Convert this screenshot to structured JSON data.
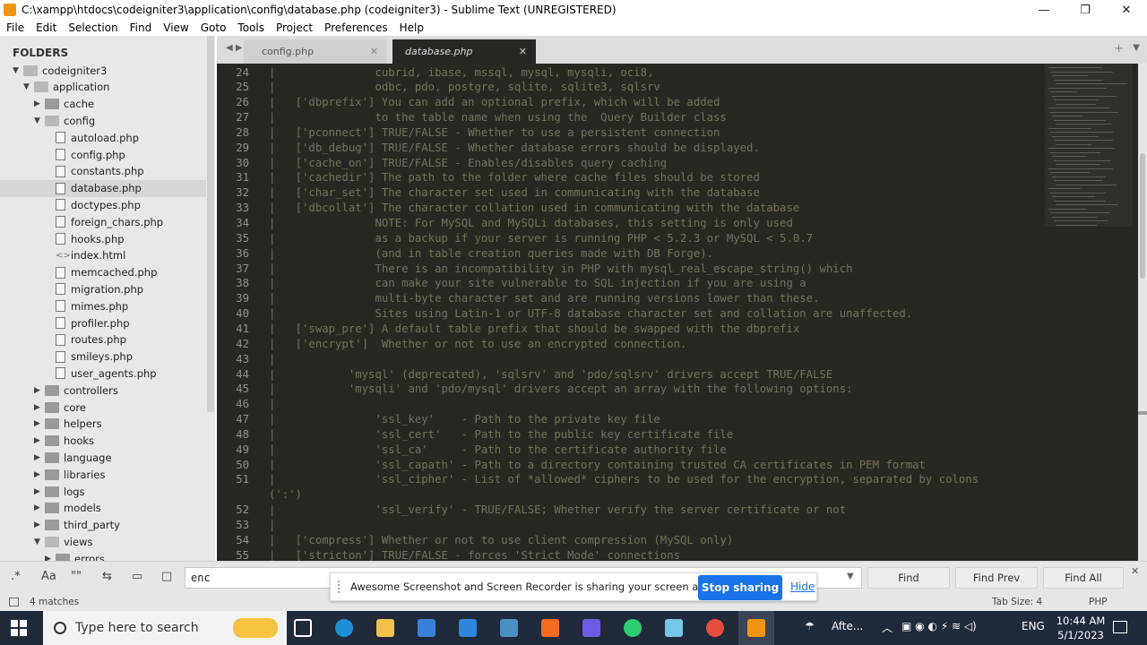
{
  "window": {
    "title": "C:\\xampp\\htdocs\\codeigniter3\\application\\config\\database.php (codeigniter3) - Sublime Text (UNREGISTERED)",
    "minimize": "—",
    "maximize": "❐",
    "close": "✕"
  },
  "menu": [
    "File",
    "Edit",
    "Selection",
    "Find",
    "View",
    "Goto",
    "Tools",
    "Project",
    "Preferences",
    "Help"
  ],
  "sidebar": {
    "heading": "FOLDERS",
    "rows": [
      {
        "label": "codeigniter3",
        "kind": "folder-open",
        "indent": 0
      },
      {
        "label": "application",
        "kind": "folder-open",
        "indent": 1
      },
      {
        "label": "cache",
        "kind": "folder",
        "indent": 2
      },
      {
        "label": "config",
        "kind": "folder-open",
        "indent": 2
      },
      {
        "label": "autoload.php",
        "kind": "file",
        "indent": 3
      },
      {
        "label": "config.php",
        "kind": "file",
        "indent": 3
      },
      {
        "label": "constants.php",
        "kind": "file",
        "indent": 3
      },
      {
        "label": "database.php",
        "kind": "file",
        "indent": 3,
        "selected": true
      },
      {
        "label": "doctypes.php",
        "kind": "file",
        "indent": 3
      },
      {
        "label": "foreign_chars.php",
        "kind": "file",
        "indent": 3
      },
      {
        "label": "hooks.php",
        "kind": "file",
        "indent": 3
      },
      {
        "label": "index.html",
        "kind": "code",
        "indent": 3
      },
      {
        "label": "memcached.php",
        "kind": "file",
        "indent": 3
      },
      {
        "label": "migration.php",
        "kind": "file",
        "indent": 3
      },
      {
        "label": "mimes.php",
        "kind": "file",
        "indent": 3
      },
      {
        "label": "profiler.php",
        "kind": "file",
        "indent": 3
      },
      {
        "label": "routes.php",
        "kind": "file",
        "indent": 3
      },
      {
        "label": "smileys.php",
        "kind": "file",
        "indent": 3
      },
      {
        "label": "user_agents.php",
        "kind": "file",
        "indent": 3
      },
      {
        "label": "controllers",
        "kind": "folder",
        "indent": 2
      },
      {
        "label": "core",
        "kind": "folder",
        "indent": 2
      },
      {
        "label": "helpers",
        "kind": "folder",
        "indent": 2
      },
      {
        "label": "hooks",
        "kind": "folder",
        "indent": 2
      },
      {
        "label": "language",
        "kind": "folder",
        "indent": 2
      },
      {
        "label": "libraries",
        "kind": "folder",
        "indent": 2
      },
      {
        "label": "logs",
        "kind": "folder",
        "indent": 2
      },
      {
        "label": "models",
        "kind": "folder",
        "indent": 2
      },
      {
        "label": "third_party",
        "kind": "folder",
        "indent": 2
      },
      {
        "label": "views",
        "kind": "folder-open",
        "indent": 2
      },
      {
        "label": "errors",
        "kind": "folder",
        "indent": 3
      }
    ]
  },
  "tabs": {
    "nav": "◀ ▶",
    "items": [
      {
        "label": "config.php",
        "close": "✕",
        "active": false
      },
      {
        "label": "database.php",
        "close": "✕",
        "active": true
      }
    ],
    "new_tab": "+",
    "dropdown": "▼"
  },
  "editor": {
    "lines": [
      {
        "n": "24",
        "text": "|               cubrid, ibase, mssql, mysql, mysqli, oci8,"
      },
      {
        "n": "25",
        "text": "|               odbc, pdo, postgre, sqlite, sqlite3, sqlsrv"
      },
      {
        "n": "26",
        "text": "|   ['dbprefix'] You can add an optional prefix, which will be added"
      },
      {
        "n": "27",
        "text": "|               to the table name when using the  Query Builder class"
      },
      {
        "n": "28",
        "text": "|   ['pconnect'] TRUE/FALSE - Whether to use a persistent connection"
      },
      {
        "n": "29",
        "text": "|   ['db_debug'] TRUE/FALSE - Whether database errors should be displayed."
      },
      {
        "n": "30",
        "text": "|   ['cache_on'] TRUE/FALSE - Enables/disables query caching"
      },
      {
        "n": "31",
        "text": "|   ['cachedir'] The path to the folder where cache files should be stored"
      },
      {
        "n": "32",
        "text": "|   ['char_set'] The character set used in communicating with the database"
      },
      {
        "n": "33",
        "text": "|   ['dbcollat'] The character collation used in communicating with the database"
      },
      {
        "n": "34",
        "text": "|               NOTE: For MySQL and MySQLi databases, this setting is only used"
      },
      {
        "n": "35",
        "text": "|               as a backup if your server is running PHP < 5.2.3 or MySQL < 5.0.7"
      },
      {
        "n": "36",
        "text": "|               (and in table creation queries made with DB Forge)."
      },
      {
        "n": "37",
        "text": "|               There is an incompatibility in PHP with mysql_real_escape_string() which"
      },
      {
        "n": "38",
        "text": "|               can make your site vulnerable to SQL injection if you are using a"
      },
      {
        "n": "39",
        "text": "|               multi-byte character set and are running versions lower than these."
      },
      {
        "n": "40",
        "text": "|               Sites using Latin-1 or UTF-8 database character set and collation are unaffected."
      },
      {
        "n": "41",
        "text": "|   ['swap_pre'] A default table prefix that should be swapped with the dbprefix"
      },
      {
        "n": "42",
        "text": "|   ['encrypt']  Whether or not to use an encrypted connection."
      },
      {
        "n": "43",
        "text": "|"
      },
      {
        "n": "44",
        "text": "|           'mysql' (deprecated), 'sqlsrv' and 'pdo/sqlsrv' drivers accept TRUE/FALSE"
      },
      {
        "n": "45",
        "text": "|           'mysqli' and 'pdo/mysql' drivers accept an array with the following options:"
      },
      {
        "n": "46",
        "text": "|"
      },
      {
        "n": "47",
        "text": "|               'ssl_key'    - Path to the private key file"
      },
      {
        "n": "48",
        "text": "|               'ssl_cert'   - Path to the public key certificate file"
      },
      {
        "n": "49",
        "text": "|               'ssl_ca'     - Path to the certificate authority file"
      },
      {
        "n": "50",
        "text": "|               'ssl_capath' - Path to a directory containing trusted CA certificates in PEM format"
      },
      {
        "n": "51",
        "text": "|               'ssl_cipher' - List of *allowed* ciphers to be used for the encryption, separated by colons"
      },
      {
        "n": "",
        "text": "(':')"
      },
      {
        "n": "52",
        "text": "|               'ssl_verify' - TRUE/FALSE; Whether verify the server certificate or not"
      },
      {
        "n": "53",
        "text": "|"
      },
      {
        "n": "54",
        "text": "|   ['compress'] Whether or not to use client compression (MySQL only)"
      },
      {
        "n": "55",
        "text": "|   ['stricton'] TRUE/FALSE - forces 'Strict Mode' connections"
      }
    ]
  },
  "findbar": {
    "opt_regex": ".*",
    "opt_case": "Aa",
    "opt_word": "\"\"",
    "opt_wrap": "⇆",
    "opt_selection": "▭",
    "opt_highlight": "□",
    "query": "enc",
    "dropdown": "▼",
    "find": "Find",
    "find_prev": "Find Prev",
    "find_all": "Find All",
    "close": "✕"
  },
  "share_banner": {
    "message": "Awesome Screenshot and Screen Recorder is sharing your screen and audio.",
    "stop": "Stop sharing",
    "hide": "Hide"
  },
  "status": {
    "matches": "4 matches",
    "tab_size": "Tab Size: 4",
    "syntax": "PHP"
  },
  "taskbar": {
    "search_placeholder": "Type here to search",
    "weather": "Afte...",
    "lang": "ENG",
    "time": "10:44 AM",
    "date": "5/1/2023"
  }
}
